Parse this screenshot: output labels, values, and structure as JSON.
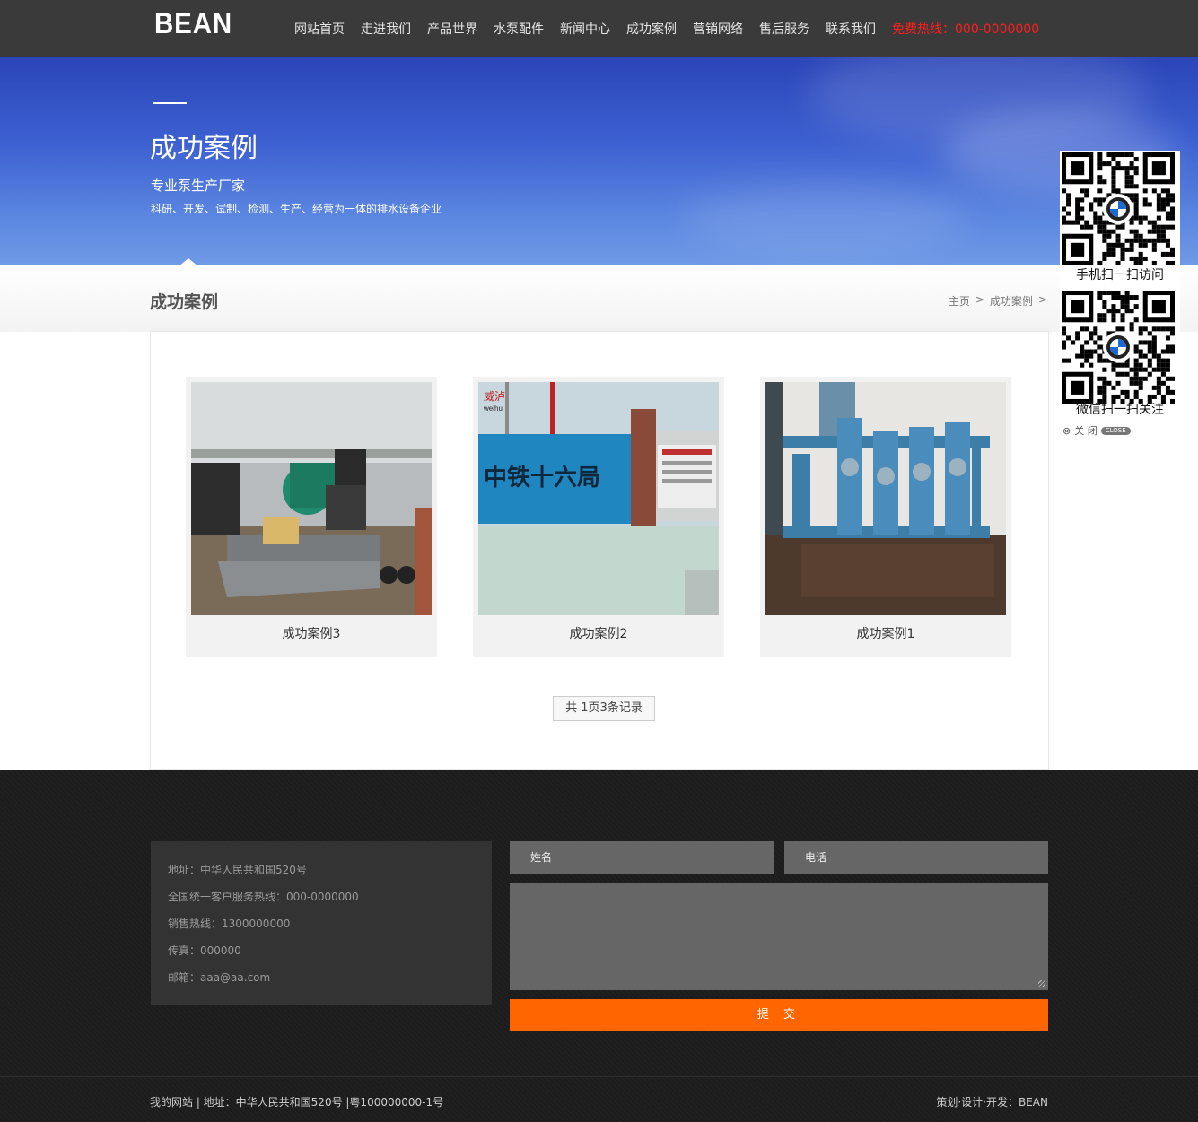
{
  "header": {
    "logo": "BEAN",
    "nav": [
      "网站首页",
      "走进我们",
      "产品世界",
      "水泵配件",
      "新闻中心",
      "成功案例",
      "营销网络",
      "售后服务",
      "联系我们"
    ],
    "hotline": "免费热线：000-0000000"
  },
  "banner": {
    "title": "成功案例",
    "subtitle": "专业泵生产厂家",
    "description": "科研、开发、试制、检测、生产、经营为一体的排水设备企业"
  },
  "section": {
    "title": "成功案例",
    "breadcrumb": [
      "主页",
      ">",
      "成功案例",
      ">"
    ]
  },
  "cases": [
    {
      "caption": "成功案例3"
    },
    {
      "caption": "成功案例2"
    },
    {
      "caption": "成功案例1"
    }
  ],
  "pager": "共 1页3条记录",
  "qr": {
    "caption_mobile": "手机扫一扫访问",
    "caption_wechat": "微信扫一扫关注",
    "close_label": "关 闭",
    "close_badge": "CLOSE"
  },
  "footer": {
    "contact": [
      "地址：中华人民共和国520号",
      "全国统一客户服务热线：000-0000000",
      "销售热线：1300000000",
      "传真：000000",
      "邮箱：aaa@aa.com"
    ],
    "name_placeholder": "姓名",
    "phone_placeholder": "电话",
    "submit_label": "提 交",
    "copyright": "我的网站 | 地址：中华人民共和国520号 |粤100000000-1号",
    "credit": "策划·设计·开发：BEAN"
  },
  "colors": {
    "header_bg": "#3a3a3a",
    "hotline": "#ff1e1e",
    "submit": "#ff6600",
    "footer_bg": "#1c1c1c"
  }
}
